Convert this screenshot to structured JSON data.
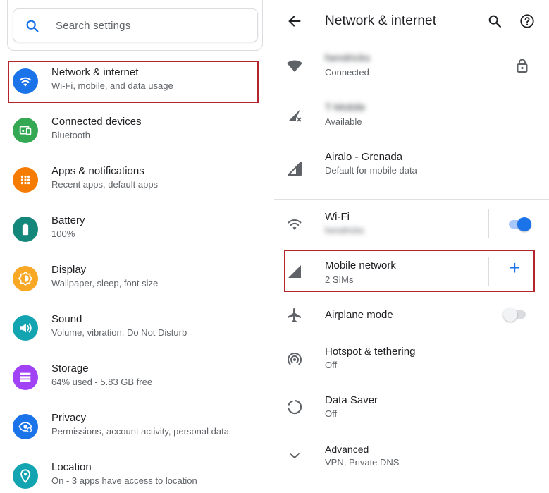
{
  "left": {
    "search": {
      "placeholder": "Search settings"
    },
    "items": [
      {
        "title": "Network & internet",
        "subtitle": "Wi-Fi, mobile, and data usage",
        "color": "#1a73e8",
        "icon": "wifi-icon"
      },
      {
        "title": "Connected devices",
        "subtitle": "Bluetooth",
        "color": "#34a853",
        "icon": "devices-icon"
      },
      {
        "title": "Apps & notifications",
        "subtitle": "Recent apps, default apps",
        "color": "#f57c00",
        "icon": "apps-grid-icon"
      },
      {
        "title": "Battery",
        "subtitle": "100%",
        "color": "#12877a",
        "icon": "battery-icon"
      },
      {
        "title": "Display",
        "subtitle": "Wallpaper, sleep, font size",
        "color": "#f9a825",
        "icon": "brightness-icon"
      },
      {
        "title": "Sound",
        "subtitle": "Volume, vibration, Do Not Disturb",
        "color": "#12a4b0",
        "icon": "volume-icon"
      },
      {
        "title": "Storage",
        "subtitle": "64% used - 5.83 GB free",
        "color": "#a142f4",
        "icon": "storage-icon"
      },
      {
        "title": "Privacy",
        "subtitle": "Permissions, account activity, personal data",
        "color": "#1a73e8",
        "icon": "privacy-eye-icon"
      },
      {
        "title": "Location",
        "subtitle": "On - 3 apps have access to location",
        "color": "#12a4b0",
        "icon": "location-pin-icon"
      }
    ]
  },
  "right": {
    "header": {
      "title": "Network & internet"
    },
    "networks": [
      {
        "title": "hendricks",
        "subtitle": "Connected",
        "blurred_title": true,
        "icon": "wifi-filled-icon",
        "trailing": "lock-icon"
      },
      {
        "title": "T-Mobile",
        "subtitle": "Available",
        "blurred_title": true,
        "icon": "signal-no-data-icon"
      },
      {
        "title": "Airalo - Grenada",
        "subtitle": "Default for mobile data",
        "blurred_title": false,
        "icon": "signal-icon"
      }
    ],
    "wifi": {
      "title": "Wi-Fi",
      "subtitle": "hendricks",
      "toggle_on": true
    },
    "mobile": {
      "title": "Mobile network",
      "subtitle": "2 SIMs",
      "action": "+"
    },
    "airplane": {
      "title": "Airplane mode",
      "toggle_on": false
    },
    "hotspot": {
      "title": "Hotspot & tethering",
      "subtitle": "Off"
    },
    "datasaver": {
      "title": "Data Saver",
      "subtitle": "Off"
    },
    "advanced": {
      "title": "Advanced",
      "subtitle": "VPN, Private DNS"
    }
  },
  "colors": {
    "accent": "#1a73e8",
    "highlight_border": "#b3262d",
    "icon_grey": "#5f6368"
  }
}
